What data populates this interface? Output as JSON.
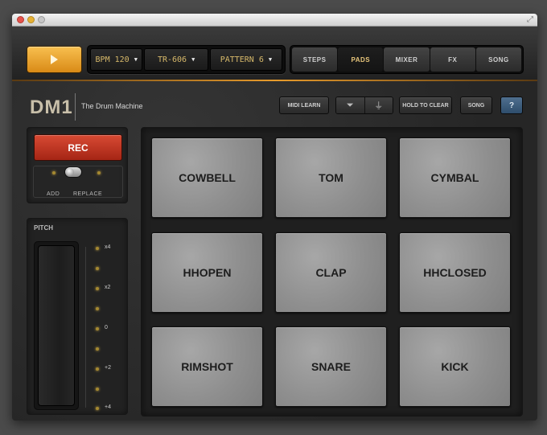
{
  "app": {
    "title": "DM1",
    "subtitle": "The Drum Machine"
  },
  "colors": {
    "accent": "#E79B2C",
    "rec": "#C73722",
    "help": "#3E5F80",
    "pad": "#939393"
  },
  "transport": {
    "play_icon": "play-icon"
  },
  "selectors": [
    {
      "label": "BPM 120"
    },
    {
      "label": "TR-606"
    },
    {
      "label": "PATTERN 6"
    }
  ],
  "tabs": [
    {
      "label": "STEPS"
    },
    {
      "label": "PADS"
    },
    {
      "label": "MIXER"
    },
    {
      "label": "FX"
    },
    {
      "label": "SONG"
    }
  ],
  "active_tab": "PADS",
  "toolbar": {
    "midi_learn": "MIDI LEARN",
    "hold_to_clear": "HOLD TO CLEAR",
    "song": "SONG",
    "help": "?"
  },
  "record": {
    "rec_label": "REC",
    "mode_add": "ADD",
    "mode_replace": "REPLACE",
    "mode_selected": "ADD"
  },
  "pitch": {
    "title": "PITCH",
    "scale": [
      "x4",
      "x2",
      "0",
      "+2",
      "+4"
    ]
  },
  "pads": [
    {
      "label": "COWBELL"
    },
    {
      "label": "TOM"
    },
    {
      "label": "CYMBAL"
    },
    {
      "label": "HHOPEN"
    },
    {
      "label": "CLAP"
    },
    {
      "label": "HHCLOSED"
    },
    {
      "label": "RIMSHOT"
    },
    {
      "label": "SNARE"
    },
    {
      "label": "KICK"
    }
  ]
}
